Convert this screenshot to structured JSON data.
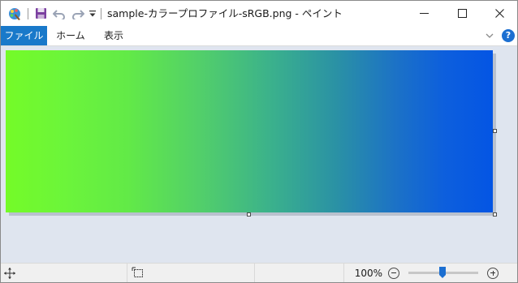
{
  "window": {
    "title": "sample-カラープロファイル-sRGB.png - ペイント"
  },
  "quick_access": {
    "icons": [
      "paint-app-icon",
      "save-icon",
      "undo-icon",
      "redo-icon",
      "customize-dropdown-icon"
    ]
  },
  "window_controls": [
    "minimize-icon",
    "maximize-icon",
    "close-icon"
  ],
  "ribbon": {
    "tabs": [
      {
        "label": "ファイル",
        "active": true
      },
      {
        "label": "ホーム",
        "active": false
      },
      {
        "label": "表示",
        "active": false
      }
    ],
    "help_label": "?"
  },
  "canvas": {
    "gradient_start": "#74fb28",
    "gradient_end": "#0455e4"
  },
  "status_bar": {
    "zoom_label": "100%",
    "zoom_level": 1.0,
    "icons": [
      "move-cursor-icon",
      "selection-size-icon",
      "zoom-out-icon",
      "zoom-in-icon"
    ]
  },
  "colors": {
    "accent": "#1979ca",
    "workspace": "#dfe5ef",
    "help": "#1c6fd1"
  }
}
